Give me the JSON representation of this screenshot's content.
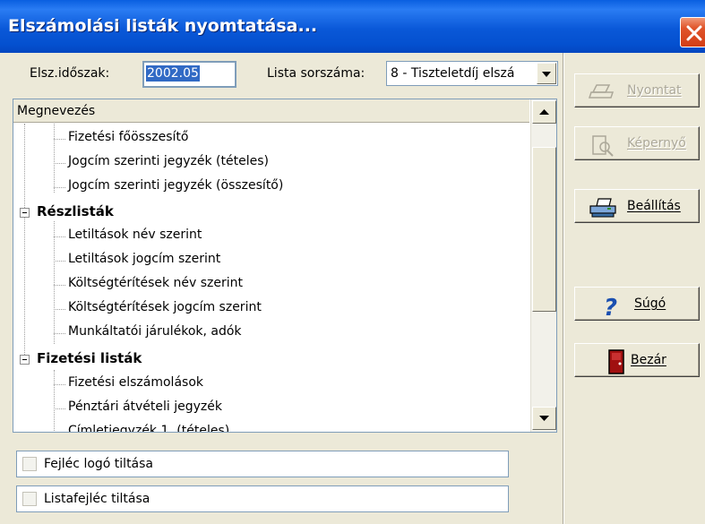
{
  "window": {
    "title": "Elszámolási listák nyomtatása..."
  },
  "form": {
    "period_label": "Elsz.időszak:",
    "period_value": "2002.05",
    "list_number_label": "Lista sorszáma:",
    "list_number_value": "8 - Tiszteletdíj elszá"
  },
  "tree": {
    "header": "Megnevezés",
    "rows": [
      {
        "label": "Fizetési főösszesítő",
        "level": 1
      },
      {
        "label": "Jogcím szerinti jegyzék (tételes)",
        "level": 1
      },
      {
        "label": "Jogcím szerinti jegyzék (összesítő)",
        "level": 1
      },
      {
        "label": "Részlisták",
        "level": 0
      },
      {
        "label": "Letiltások név szerint",
        "level": 1
      },
      {
        "label": "Letiltások jogcím szerint",
        "level": 1
      },
      {
        "label": "Költségtérítések név szerint",
        "level": 1
      },
      {
        "label": "Költségtérítések jogcím szerint",
        "level": 1
      },
      {
        "label": "Munkáltatói járulékok, adók",
        "level": 1
      },
      {
        "label": "Fizetési listák",
        "level": 0
      },
      {
        "label": "Fizetési elszámolások",
        "level": 1
      },
      {
        "label": "Pénztári átvételi jegyzék",
        "level": 1
      },
      {
        "label": "Címletjegyzék 1. (tételes)",
        "level": 1
      }
    ]
  },
  "options": {
    "header_logo": "Fejléc logó tiltása",
    "list_header": "Listafejléc tiltása"
  },
  "buttons": {
    "print": "Nyomtat",
    "screen": "Képernyő",
    "settings": "Beállítás",
    "help": "Súgó",
    "close": "Bezár"
  },
  "colors": {
    "titlebar": "#0a58d8",
    "selection": "#316ac5",
    "close_button": "#d33d16"
  },
  "icons": {
    "close": "close-x-icon",
    "print": "printer-icon",
    "screen": "preview-magnifier-icon",
    "settings": "printer-settings-icon",
    "help": "question-mark-icon",
    "exit": "door-icon"
  }
}
